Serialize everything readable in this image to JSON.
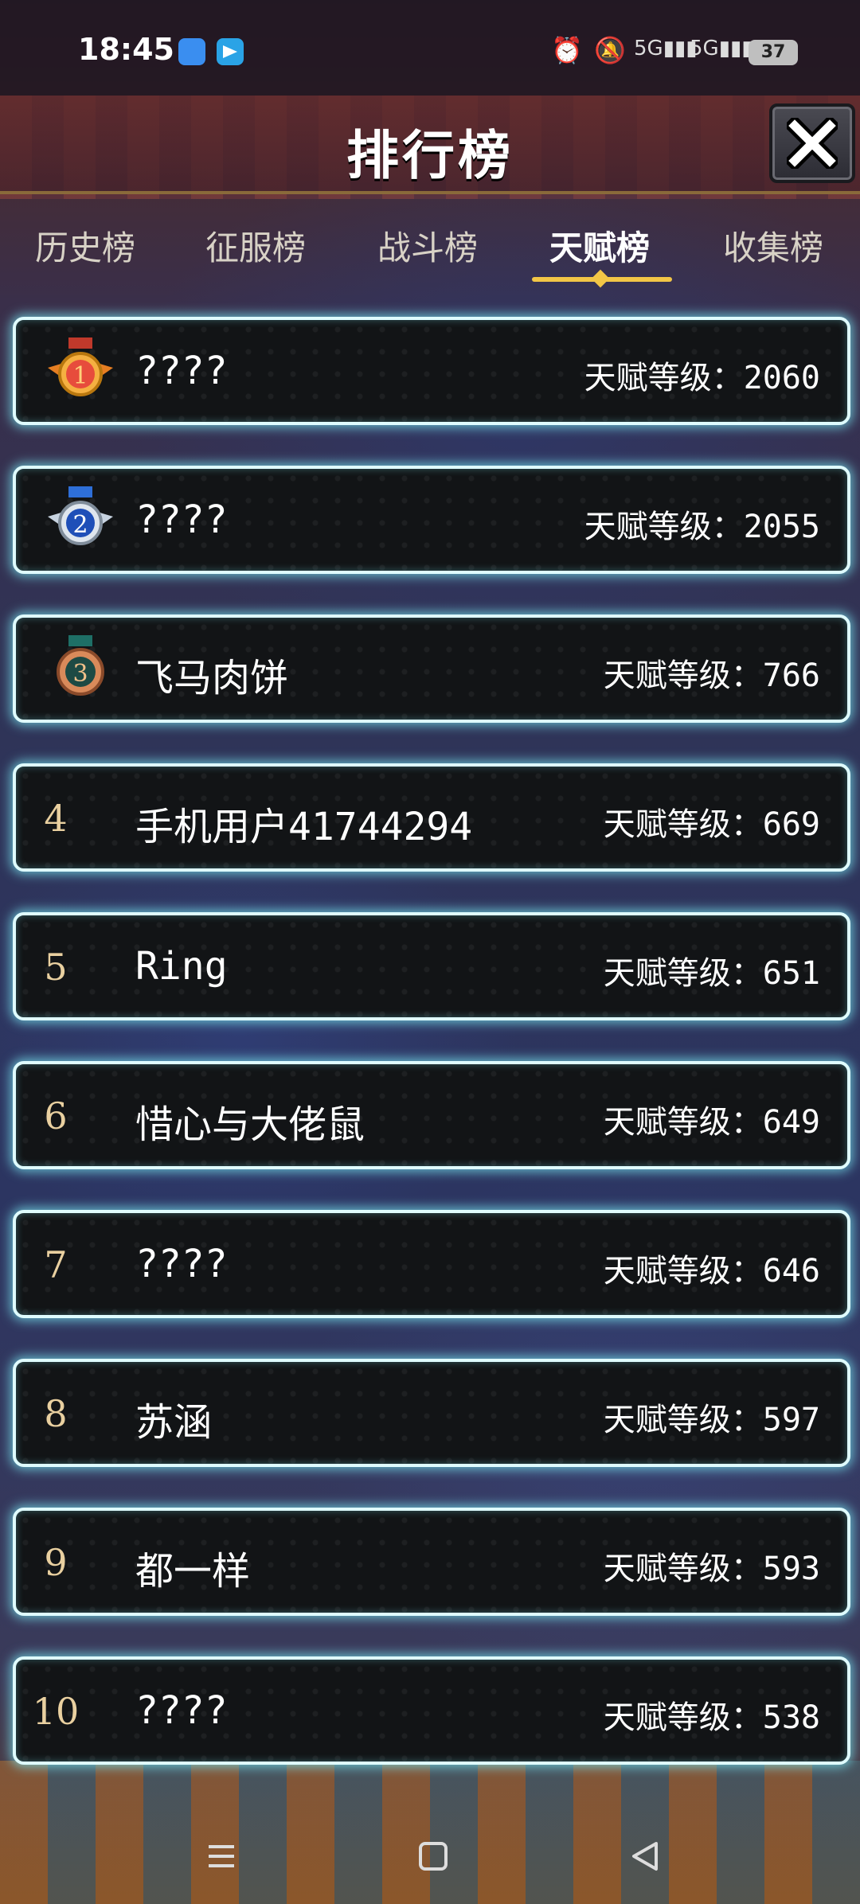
{
  "status_bar": {
    "time": "18:45",
    "battery": "37",
    "icons": [
      "alarm-icon",
      "mute-icon",
      "signal-5g-icon",
      "signal-5g-icon",
      "battery-icon"
    ]
  },
  "header": {
    "title": "排行榜",
    "close_icon": "close-icon"
  },
  "tabs": [
    {
      "label": "历史榜",
      "active": false
    },
    {
      "label": "征服榜",
      "active": false
    },
    {
      "label": "战斗榜",
      "active": false
    },
    {
      "label": "天赋榜",
      "active": true
    },
    {
      "label": "收集榜",
      "active": false
    }
  ],
  "score_label": "天赋等级：",
  "entries": [
    {
      "rank": "1",
      "medal": "gold-medal-icon",
      "name": "????",
      "score": "2060"
    },
    {
      "rank": "2",
      "medal": "silver-medal-icon",
      "name": "????",
      "score": "2055"
    },
    {
      "rank": "3",
      "medal": "bronze-medal-icon",
      "name": "飞马肉饼",
      "score": "766"
    },
    {
      "rank": "4",
      "name": "手机用户41744294",
      "score": "669"
    },
    {
      "rank": "5",
      "name": "Ring",
      "score": "651"
    },
    {
      "rank": "6",
      "name": "惜心与大佬鼠",
      "score": "649"
    },
    {
      "rank": "7",
      "name": "????",
      "score": "646"
    },
    {
      "rank": "8",
      "name": "苏涵",
      "score": "597"
    },
    {
      "rank": "9",
      "name": "都一样",
      "score": "593"
    },
    {
      "rank": "10",
      "name": "????",
      "score": "538"
    }
  ],
  "colors": {
    "row_glow": "#7fe6f0",
    "tab_active_underline": "#f2c646",
    "rank_text": "#e9d0a0"
  }
}
